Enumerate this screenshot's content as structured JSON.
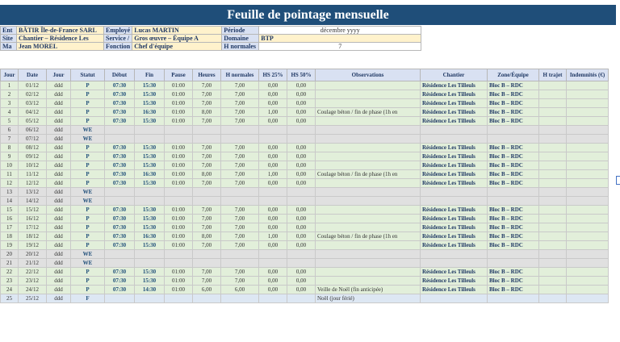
{
  "title": "Feuille de pointage mensuelle",
  "info": {
    "r1": [
      "Ent",
      "BÂTIR Île-de-France SARL",
      "Employé",
      "Lucas MARTIN",
      "Période",
      "décembre yyyy"
    ],
    "r2": [
      "Site",
      "Chantier – Résidence Les",
      "Service /",
      "Gros œuvre – Équipe A",
      "Domaine",
      "BTP"
    ],
    "r3": [
      "Ma",
      "Jean MOREL",
      "Fonction",
      "Chef d'équipe",
      "H normales",
      "7"
    ]
  },
  "headers": [
    "Jour",
    "Date",
    "Jour",
    "Statut",
    "Début",
    "Fin",
    "Pause",
    "Heures",
    "H normales",
    "HS 25%",
    "HS 50%",
    "Observations",
    "Chantier",
    "Zone/Équipe",
    "H trajet",
    "Indemnités (€)"
  ],
  "rows": [
    [
      "1",
      "01/12",
      "ddd",
      "P",
      "07:30",
      "15:30",
      "01:00",
      "7,00",
      "7,00",
      "0,00",
      "0,00",
      "",
      "Résidence Les Tilleuls",
      "Bloc B – RDC",
      "",
      ""
    ],
    [
      "2",
      "02/12",
      "ddd",
      "P",
      "07:30",
      "15:30",
      "01:00",
      "7,00",
      "7,00",
      "0,00",
      "0,00",
      "",
      "Résidence Les Tilleuls",
      "Bloc B – RDC",
      "",
      ""
    ],
    [
      "3",
      "03/12",
      "ddd",
      "P",
      "07:30",
      "15:30",
      "01:00",
      "7,00",
      "7,00",
      "0,00",
      "0,00",
      "",
      "Résidence Les Tilleuls",
      "Bloc B – RDC",
      "",
      ""
    ],
    [
      "4",
      "04/12",
      "ddd",
      "P",
      "07:30",
      "16:30",
      "01:00",
      "8,00",
      "7,00",
      "1,00",
      "0,00",
      "Coulage béton / fin de phase (1h en",
      "Résidence Les Tilleuls",
      "Bloc B – RDC",
      "",
      ""
    ],
    [
      "5",
      "05/12",
      "ddd",
      "P",
      "07:30",
      "15:30",
      "01:00",
      "7,00",
      "7,00",
      "0,00",
      "0,00",
      "",
      "Résidence Les Tilleuls",
      "Bloc B – RDC",
      "",
      ""
    ],
    [
      "6",
      "06/12",
      "ddd",
      "WE",
      "",
      "",
      "",
      "",
      "",
      "",
      "",
      "",
      "",
      "",
      "",
      ""
    ],
    [
      "7",
      "07/12",
      "ddd",
      "WE",
      "",
      "",
      "",
      "",
      "",
      "",
      "",
      "",
      "",
      "",
      "",
      ""
    ],
    [
      "8",
      "08/12",
      "ddd",
      "P",
      "07:30",
      "15:30",
      "01:00",
      "7,00",
      "7,00",
      "0,00",
      "0,00",
      "",
      "Résidence Les Tilleuls",
      "Bloc B – RDC",
      "",
      ""
    ],
    [
      "9",
      "09/12",
      "ddd",
      "P",
      "07:30",
      "15:30",
      "01:00",
      "7,00",
      "7,00",
      "0,00",
      "0,00",
      "",
      "Résidence Les Tilleuls",
      "Bloc B – RDC",
      "",
      ""
    ],
    [
      "10",
      "10/12",
      "ddd",
      "P",
      "07:30",
      "15:30",
      "01:00",
      "7,00",
      "7,00",
      "0,00",
      "0,00",
      "",
      "Résidence Les Tilleuls",
      "Bloc B – RDC",
      "",
      ""
    ],
    [
      "11",
      "11/12",
      "ddd",
      "P",
      "07:30",
      "16:30",
      "01:00",
      "8,00",
      "7,00",
      "1,00",
      "0,00",
      "Coulage béton / fin de phase (1h en",
      "Résidence Les Tilleuls",
      "Bloc B – RDC",
      "",
      ""
    ],
    [
      "12",
      "12/12",
      "ddd",
      "P",
      "07:30",
      "15:30",
      "01:00",
      "7,00",
      "7,00",
      "0,00",
      "0,00",
      "",
      "Résidence Les Tilleuls",
      "Bloc B – RDC",
      "",
      ""
    ],
    [
      "13",
      "13/12",
      "ddd",
      "WE",
      "",
      "",
      "",
      "",
      "",
      "",
      "",
      "",
      "",
      "",
      "",
      ""
    ],
    [
      "14",
      "14/12",
      "ddd",
      "WE",
      "",
      "",
      "",
      "",
      "",
      "",
      "",
      "",
      "",
      "",
      "",
      ""
    ],
    [
      "15",
      "15/12",
      "ddd",
      "P",
      "07:30",
      "15:30",
      "01:00",
      "7,00",
      "7,00",
      "0,00",
      "0,00",
      "",
      "Résidence Les Tilleuls",
      "Bloc B – RDC",
      "",
      ""
    ],
    [
      "16",
      "16/12",
      "ddd",
      "P",
      "07:30",
      "15:30",
      "01:00",
      "7,00",
      "7,00",
      "0,00",
      "0,00",
      "",
      "Résidence Les Tilleuls",
      "Bloc B – RDC",
      "",
      ""
    ],
    [
      "17",
      "17/12",
      "ddd",
      "P",
      "07:30",
      "15:30",
      "01:00",
      "7,00",
      "7,00",
      "0,00",
      "0,00",
      "",
      "Résidence Les Tilleuls",
      "Bloc B – RDC",
      "",
      ""
    ],
    [
      "18",
      "18/12",
      "ddd",
      "P",
      "07:30",
      "16:30",
      "01:00",
      "8,00",
      "7,00",
      "1,00",
      "0,00",
      "Coulage béton / fin de phase (1h en",
      "Résidence Les Tilleuls",
      "Bloc B – RDC",
      "",
      ""
    ],
    [
      "19",
      "19/12",
      "ddd",
      "P",
      "07:30",
      "15:30",
      "01:00",
      "7,00",
      "7,00",
      "0,00",
      "0,00",
      "",
      "Résidence Les Tilleuls",
      "Bloc B – RDC",
      "",
      ""
    ],
    [
      "20",
      "20/12",
      "ddd",
      "WE",
      "",
      "",
      "",
      "",
      "",
      "",
      "",
      "",
      "",
      "",
      "",
      ""
    ],
    [
      "21",
      "21/12",
      "ddd",
      "WE",
      "",
      "",
      "",
      "",
      "",
      "",
      "",
      "",
      "",
      "",
      "",
      ""
    ],
    [
      "22",
      "22/12",
      "ddd",
      "P",
      "07:30",
      "15:30",
      "01:00",
      "7,00",
      "7,00",
      "0,00",
      "0,00",
      "",
      "Résidence Les Tilleuls",
      "Bloc B – RDC",
      "",
      ""
    ],
    [
      "23",
      "23/12",
      "ddd",
      "P",
      "07:30",
      "15:30",
      "01:00",
      "7,00",
      "7,00",
      "0,00",
      "0,00",
      "",
      "Résidence Les Tilleuls",
      "Bloc B – RDC",
      "",
      ""
    ],
    [
      "24",
      "24/12",
      "ddd",
      "P",
      "07:30",
      "14:30",
      "01:00",
      "6,00",
      "6,00",
      "0,00",
      "0,00",
      "Veille de Noël (fin anticipée)",
      "Résidence Les Tilleuls",
      "Bloc B – RDC",
      "",
      ""
    ],
    [
      "25",
      "25/12",
      "ddd",
      "F",
      "",
      "",
      "",
      "",
      "",
      "",
      "",
      "Noël (jour férié)",
      "",
      "",
      "",
      ""
    ]
  ]
}
